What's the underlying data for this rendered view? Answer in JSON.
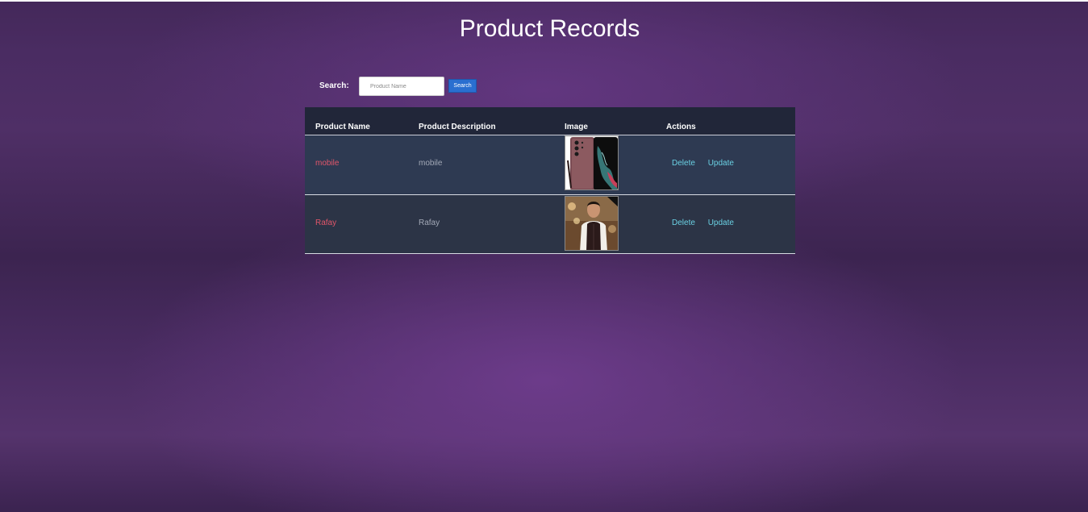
{
  "page": {
    "title": "Product Records"
  },
  "search": {
    "label": "Search:",
    "placeholder": "Product Name",
    "value": "",
    "button_label": "Search"
  },
  "table": {
    "headers": {
      "name": "Product Name",
      "description": "Product Description",
      "image": "Image",
      "actions": "Actions"
    },
    "rows": [
      {
        "name": "mobile",
        "description": "mobile",
        "image_icon": "smartphone-product-image",
        "delete_label": "Delete",
        "update_label": "Update"
      },
      {
        "name": "Rafay",
        "description": "Rafay",
        "image_icon": "person-portrait-image",
        "delete_label": "Delete",
        "update_label": "Update"
      }
    ]
  },
  "colors": {
    "background": "#4a2c62",
    "table_header": "#212639",
    "row_bg": "#2e3a52",
    "name_text": "#e2566a",
    "action_link": "#6ad0e3",
    "search_button": "#2a6fd0"
  }
}
